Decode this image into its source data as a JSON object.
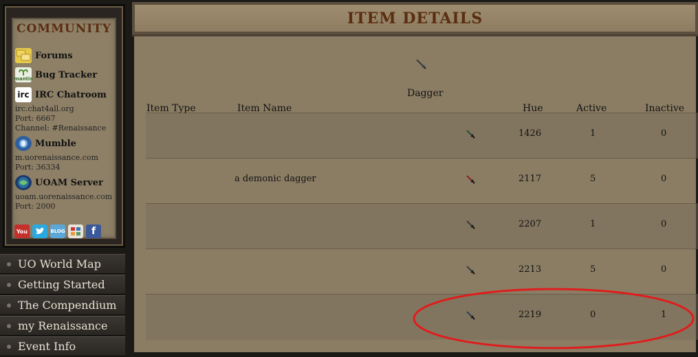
{
  "community": {
    "title": "COMMUNITY",
    "links": [
      {
        "label": "Forums"
      },
      {
        "label": "Bug Tracker",
        "icon_text": "mantis"
      },
      {
        "label": "IRC Chatroom",
        "icon_text": "irc",
        "details": [
          "irc.chat4all.org",
          "Port: 6667",
          "Channel: #Renaissance"
        ]
      },
      {
        "label": "Mumble",
        "details": [
          "m.uorenaissance.com",
          "Port: 36334"
        ]
      },
      {
        "label": "UOAM Server",
        "details": [
          "uoam.uorenaissance.com",
          "Port: 2000"
        ]
      }
    ],
    "social_icons": [
      "youtube-icon",
      "twitter-icon",
      "blog-icon",
      "gallery-icon",
      "facebook-icon"
    ],
    "social_glyphs": {
      "youtube": "You",
      "blog": "BLOG",
      "facebook": "f"
    }
  },
  "nav": [
    {
      "label": "UO World Map"
    },
    {
      "label": "Getting Started"
    },
    {
      "label": "The Compendium"
    },
    {
      "label": "my Renaissance"
    },
    {
      "label": "Event Info"
    }
  ],
  "main": {
    "title": "ITEM DETAILS",
    "item_title": "Dagger",
    "columns": {
      "item_type": "Item Type",
      "item_name": "Item Name",
      "hue": "Hue",
      "active": "Active",
      "inactive": "Inactive"
    },
    "rows": [
      {
        "item_type": "",
        "item_name": "",
        "hue": "1426",
        "active": "1",
        "inactive": "0",
        "dagger_color": "#2e4a3e"
      },
      {
        "item_type": "",
        "item_name": "a demonic dagger",
        "hue": "2117",
        "active": "5",
        "inactive": "0",
        "dagger_color": "#8a1d1d"
      },
      {
        "item_type": "",
        "item_name": "",
        "hue": "2207",
        "active": "1",
        "inactive": "0",
        "dagger_color": "#3b3b3b"
      },
      {
        "item_type": "",
        "item_name": "",
        "hue": "2213",
        "active": "5",
        "inactive": "0",
        "dagger_color": "#3b3b3b"
      },
      {
        "item_type": "",
        "item_name": "",
        "hue": "2219",
        "active": "0",
        "inactive": "1",
        "dagger_color": "#2b3e57"
      }
    ]
  },
  "colors": {
    "title_text": "#5a2d10",
    "parchment": "#8b7d64",
    "annotation_circle": "#e01c1c"
  }
}
